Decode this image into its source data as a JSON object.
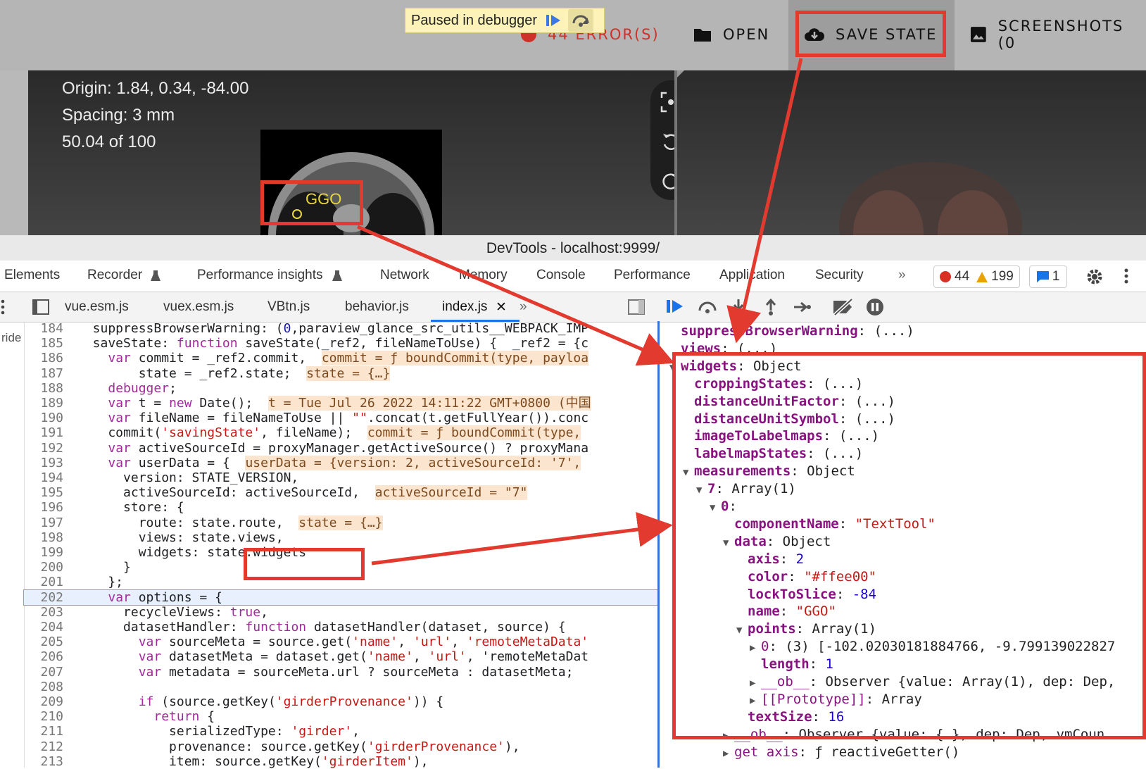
{
  "topbar": {
    "paused_label": "Paused in debugger",
    "errors_label": "44 ERROR(S)",
    "open_label": "OPEN",
    "save_state_label": "SAVE STATE",
    "screenshots_label": "SCREENSHOTS (0"
  },
  "viewer": {
    "origin": "Origin: 1.84, 0.34, -84.00",
    "spacing": "Spacing: 3 mm",
    "slice": "50.04 of 100",
    "annotation_label": "GGO"
  },
  "devtools": {
    "window_title": "DevTools - localhost:9999/",
    "tabs": [
      "Elements",
      "Recorder",
      "Performance insights",
      "Network",
      "Memory",
      "Console",
      "Performance",
      "Application",
      "Security"
    ],
    "error_count": "44",
    "warning_count": "199",
    "message_count": "1",
    "files": [
      "vue.esm.js",
      "vuex.esm.js",
      "VBtn.js",
      "behavior.js",
      "index.js"
    ],
    "gutter_label": "ride"
  },
  "code_lines": [
    {
      "n": "184",
      "t": "  suppressBrowserWarning: (0,paraview_glance_src_utils__WEBPACK_IMP"
    },
    {
      "n": "185",
      "t": "  saveState: function saveState(_ref2, fileNameToUse) {  _ref2 = {c"
    },
    {
      "n": "186",
      "t": "    var commit = _ref2.commit,  commit = ƒ boundCommit(type, payloa"
    },
    {
      "n": "187",
      "t": "        state = _ref2.state;  state = {…}"
    },
    {
      "n": "188",
      "t": "    debugger;"
    },
    {
      "n": "189",
      "t": "    var t = new Date();  t = Tue Jul 26 2022 14:11:22 GMT+0800 (中国"
    },
    {
      "n": "190",
      "t": "    var fileName = fileNameToUse || \"\".concat(t.getFullYear()).conc"
    },
    {
      "n": "191",
      "t": "    commit('savingState', fileName);  commit = ƒ boundCommit(type,"
    },
    {
      "n": "192",
      "t": "    var activeSourceId = proxyManager.getActiveSource() ? proxyMana"
    },
    {
      "n": "193",
      "t": "    var userData = {  userData = {version: 2, activeSourceId: '7',"
    },
    {
      "n": "194",
      "t": "      version: STATE_VERSION,"
    },
    {
      "n": "195",
      "t": "      activeSourceId: activeSourceId,  activeSourceId = \"7\""
    },
    {
      "n": "196",
      "t": "      store: {"
    },
    {
      "n": "197",
      "t": "        route: state.route,  state = {…}"
    },
    {
      "n": "198",
      "t": "        views: state.views,"
    },
    {
      "n": "199",
      "t": "        widgets: state.widgets"
    },
    {
      "n": "200",
      "t": "      }"
    },
    {
      "n": "201",
      "t": "    };"
    },
    {
      "n": "202",
      "t": "    var options = {"
    },
    {
      "n": "203",
      "t": "      recycleViews: true,"
    },
    {
      "n": "204",
      "t": "      datasetHandler: function datasetHandler(dataset, source) {"
    },
    {
      "n": "205",
      "t": "        var sourceMeta = source.get('name', 'url', 'remoteMetaData'"
    },
    {
      "n": "206",
      "t": "        var datasetMeta = dataset.get('name', 'url', 'remoteMetaDat"
    },
    {
      "n": "207",
      "t": "        var metadata = sourceMeta.url ? sourceMeta : datasetMeta;"
    },
    {
      "n": "208",
      "t": ""
    },
    {
      "n": "209",
      "t": "        if (source.getKey('girderProvenance')) {"
    },
    {
      "n": "210",
      "t": "          return {"
    },
    {
      "n": "211",
      "t": "            serializedType: 'girder',"
    },
    {
      "n": "212",
      "t": "            provenance: source.getKey('girderProvenance'),"
    },
    {
      "n": "213",
      "t": "            item: source.getKey('girderItem'),"
    }
  ],
  "scope_lines": [
    {
      "k": "suppressBrowserWarning",
      "v": "(...)"
    },
    {
      "k": "views",
      "v": "(...)"
    },
    {
      "k": "widgets",
      "v": "Object"
    },
    {
      "k": "croppingStates",
      "v": "(...)"
    },
    {
      "k": "distanceUnitFactor",
      "v": "(...)"
    },
    {
      "k": "distanceUnitSymbol",
      "v": "(...)"
    },
    {
      "k": "imageToLabelmaps",
      "v": "(...)"
    },
    {
      "k": "labelmapStates",
      "v": "(...)"
    },
    {
      "k": "measurements",
      "v": "Object"
    },
    {
      "k": "7",
      "v": "Array(1)"
    },
    {
      "k": "0",
      "v": ""
    },
    {
      "k": "componentName",
      "v": "\"TextTool\""
    },
    {
      "k": "data",
      "v": "Object"
    },
    {
      "k": "axis",
      "v": "2"
    },
    {
      "k": "color",
      "v": "\"#ffee00\""
    },
    {
      "k": "lockToSlice",
      "v": "-84"
    },
    {
      "k": "name",
      "v": "\"GGO\""
    },
    {
      "k": "points",
      "v": "Array(1)"
    },
    {
      "k": "0",
      "v": "(3) [-102.02030181884766, -9.799139022827"
    },
    {
      "k": "length",
      "v": "1"
    },
    {
      "k": "__ob__",
      "v": "Observer {value: Array(1), dep: Dep,"
    },
    {
      "k": "[[Prototype]]",
      "v": "Array"
    },
    {
      "k": "textSize",
      "v": "16"
    },
    {
      "k": "__ob__",
      "v": "Observer {value: {…}, dep: Dep, vmCoun"
    },
    {
      "k": "get axis",
      "v": "ƒ reactiveGetter()"
    }
  ],
  "colors": {
    "annotation_red": "#e23a2f",
    "accent_blue": "#3b6fd8",
    "ggo_yellow": "#e8d83a"
  }
}
